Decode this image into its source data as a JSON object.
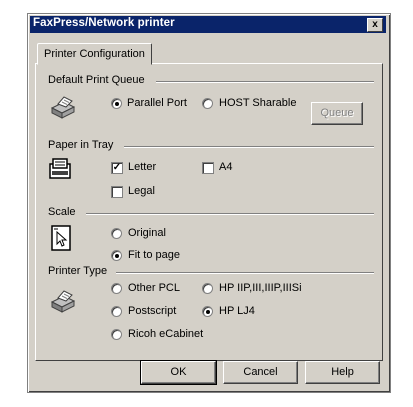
{
  "window": {
    "title": "FaxPress/Network printer",
    "close_label": "x"
  },
  "tabs": [
    {
      "label": "Printer Configuration"
    }
  ],
  "default_print_queue": {
    "label": "Default Print Queue",
    "options": [
      {
        "label": "Parallel Port",
        "selected": true
      },
      {
        "label": "HOST Sharable",
        "selected": false
      }
    ],
    "queue_button": "Queue"
  },
  "paper_in_tray": {
    "label": "Paper in Tray",
    "options": [
      {
        "label": "Letter",
        "checked": true
      },
      {
        "label": "A4",
        "checked": false
      },
      {
        "label": "Legal",
        "checked": false
      }
    ]
  },
  "scale": {
    "label": "Scale",
    "options": [
      {
        "label": "Original",
        "selected": false
      },
      {
        "label": "Fit to page",
        "selected": true
      }
    ]
  },
  "printer_type": {
    "label": "Printer Type",
    "options": [
      {
        "label": "Other PCL",
        "selected": false
      },
      {
        "label": "HP IIP,III,IIIP,IIISi",
        "selected": false
      },
      {
        "label": "Postscript",
        "selected": false
      },
      {
        "label": "HP LJ4",
        "selected": true
      },
      {
        "label": "Ricoh eCabinet",
        "selected": false
      }
    ]
  },
  "buttons": {
    "ok": "OK",
    "cancel": "Cancel",
    "help": "Help"
  },
  "colors": {
    "titlebar": "#0a246a",
    "face": "#d4d0c8"
  },
  "icons": [
    "printer-icon",
    "paper-tray-icon",
    "fit-page-icon",
    "printer-icon"
  ]
}
